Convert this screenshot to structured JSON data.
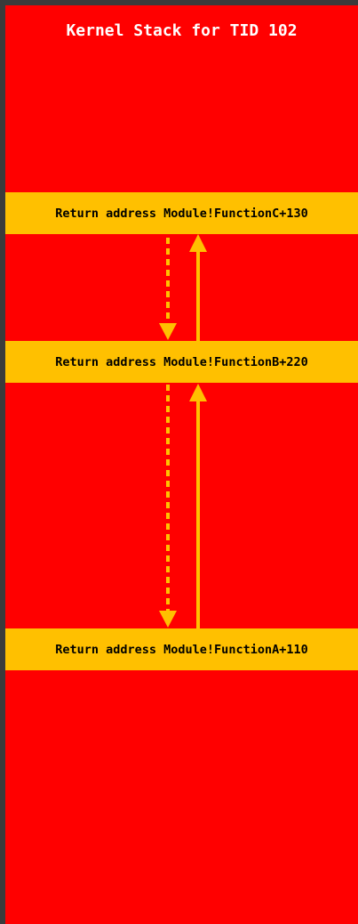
{
  "title": "Kernel Stack for TID 102",
  "frames": [
    {
      "label": "Return address Module!FunctionC+130"
    },
    {
      "label": "Return address Module!FunctionB+220"
    },
    {
      "label": "Return address Module!FunctionA+110"
    }
  ],
  "colors": {
    "background": "#3b3b3b",
    "stack": "#ff0000",
    "frame": "#ffc000",
    "arrow": "#ffc000",
    "title_text": "#ffffff",
    "frame_text": "#000000"
  }
}
